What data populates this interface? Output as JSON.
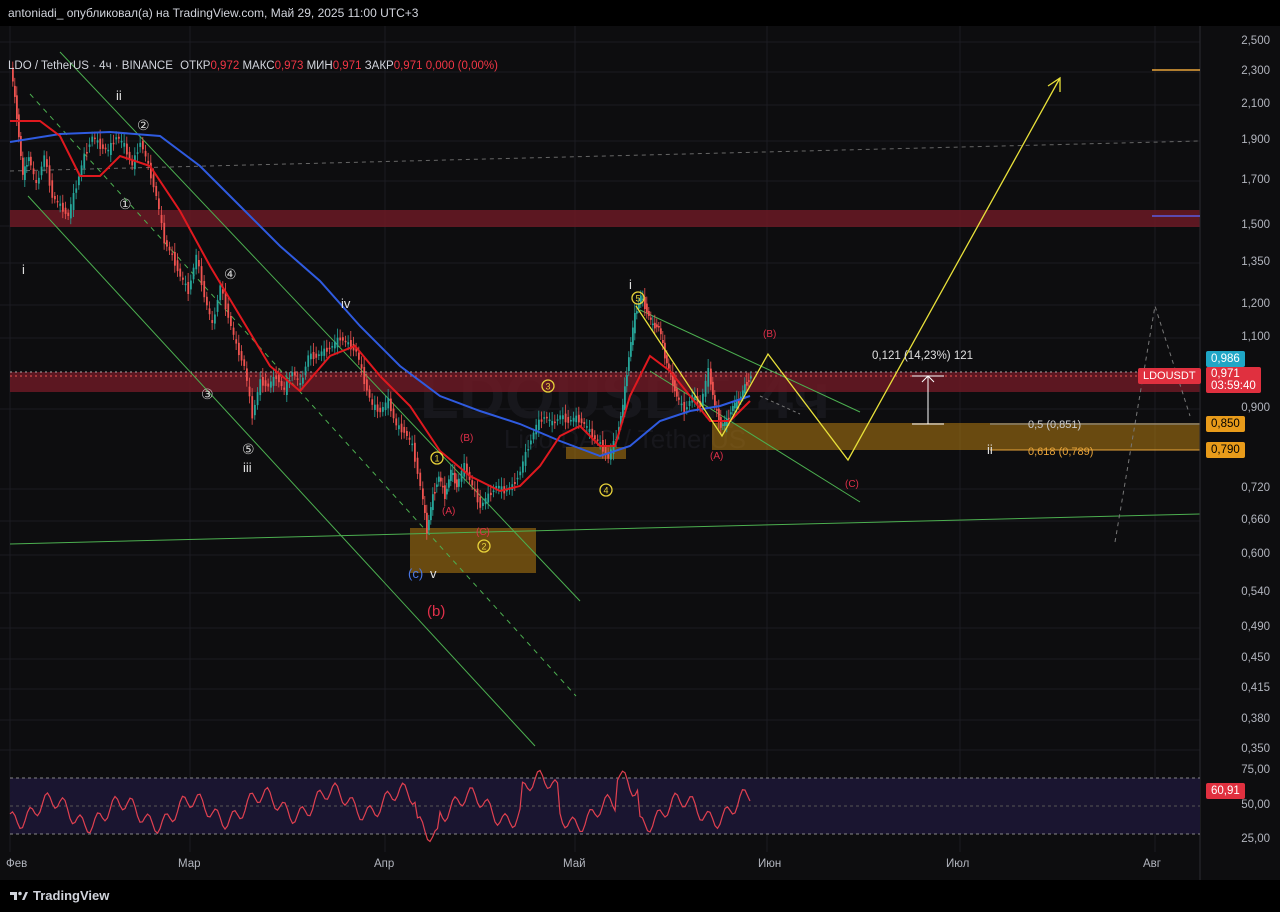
{
  "header": {
    "publisher_line": "antoniadi_ опубликовал(а) на TradingView.com, Май 29, 2025 11:00 UTC+3"
  },
  "legend": {
    "symbol": "LDO / TetherUS · 4ч · BINANCE",
    "open_label": "ОТКР",
    "open_value": "0,972",
    "high_label": "МАКС",
    "high_value": "0,973",
    "low_label": "МИН",
    "low_value": "0,971",
    "close_label": "ЗАКР",
    "close_value": "0,971",
    "change": "0,000 (0,00%)"
  },
  "watermark": {
    "symbol": "LDOUSDT, 4ч",
    "name": "Lido DAO / TetherUS"
  },
  "price_axis": [
    "2,500",
    "2,300",
    "2,100",
    "1,900",
    "1,700",
    "1,500",
    "1,350",
    "1,200",
    "1,100",
    "0,900",
    "0,720",
    "0,660",
    "0,600",
    "0,540",
    "0,490",
    "0,450",
    "0,415",
    "0,380",
    "0,350"
  ],
  "rsi_axis": [
    "75,00",
    "50,00",
    "25,00"
  ],
  "price_tags": {
    "level_1": "0,986",
    "symbol_tag": "LDOUSDT",
    "last_price": "0,971",
    "countdown": "03:59:40",
    "level_2": "0,850",
    "level_3": "0,790",
    "rsi_value": "60,91"
  },
  "time_axis": [
    "Фев",
    "Мар",
    "Апр",
    "Май",
    "Июн",
    "Июл",
    "Авг"
  ],
  "annotations": {
    "measure": "0,121 (14,23%) 121",
    "fib_05": "0,5 (0,851)",
    "fib_0618": "0,618 (0,789)",
    "wave_i_left": "i",
    "wave_ii_left": "ii",
    "wave_iii": "iii",
    "wave_iv": "iv",
    "wave_v": "v",
    "wave_c_blue": "(c)",
    "wave_b_red": "(b)",
    "wave_i_right": "i",
    "wave_ii_right": "ii",
    "wave_A1": "(A)",
    "wave_B1": "(B)",
    "wave_C1": "(C)",
    "wave_A2": "(A)",
    "wave_B2": "(B)",
    "wave_C2": "(C)",
    "c1": "①",
    "c2": "②",
    "c3": "③",
    "c4": "④",
    "c5": "⑤",
    "y1": "1",
    "y2": "2",
    "y3": "3",
    "y4": "4",
    "y5": "5"
  },
  "footer": {
    "brand": "TradingView"
  },
  "colors": {
    "up": "#26a69a",
    "down": "#ef5350",
    "ma_red": "#e0191f",
    "ma_blue": "#2f5be0",
    "zone_red": "#6b1a24",
    "zone_orange": "#b77d12",
    "yellow": "#e8e03a",
    "green_line": "#4caf50",
    "rsi": "#e04050"
  }
}
